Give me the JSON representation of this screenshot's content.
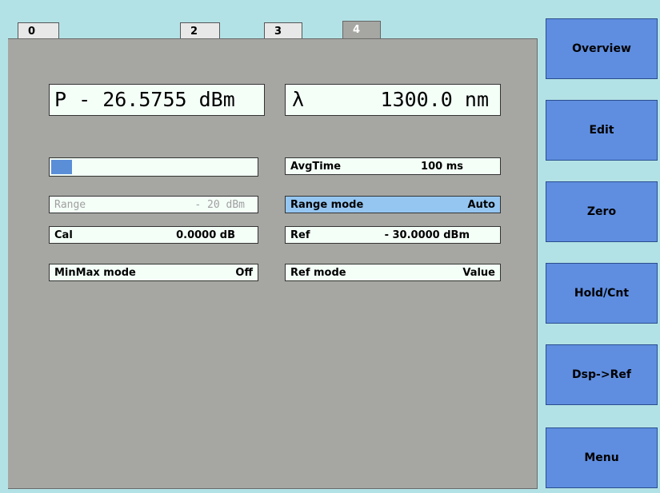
{
  "tabs": [
    {
      "label": "0"
    },
    {
      "label": "2"
    },
    {
      "label": "3"
    },
    {
      "label": "4"
    }
  ],
  "display": {
    "power": "P - 26.5755 dBm",
    "wavelength_symbol": "λ",
    "wavelength": "1300.0 nm"
  },
  "level_bar": {
    "fill_fraction": 0.1
  },
  "fields": {
    "range": {
      "label": "Range",
      "value": "- 20 dBm"
    },
    "cal": {
      "label": "Cal",
      "value": "0.0000 dB"
    },
    "minmax": {
      "label": "MinMax mode",
      "value": "Off"
    },
    "avgtime": {
      "label": "AvgTime",
      "value": "100 ms"
    },
    "rangemode": {
      "label": "Range mode",
      "value": "Auto"
    },
    "ref": {
      "label": "Ref",
      "value": "- 30.0000 dBm"
    },
    "refmode": {
      "label": "Ref mode",
      "value": "Value"
    }
  },
  "sidebar": {
    "buttons": [
      {
        "label": "Overview"
      },
      {
        "label": "Edit"
      },
      {
        "label": "Zero"
      },
      {
        "label": "Hold/Cnt"
      },
      {
        "label": "Dsp->Ref"
      },
      {
        "label": "Menu"
      }
    ]
  },
  "colors": {
    "background": "#b3e2e6",
    "panel": "#a6a7a3",
    "field": "#f4fff8",
    "selected": "#95c6f1",
    "button": "#5f8ee0",
    "bar_fill": "#5a8fd8"
  }
}
